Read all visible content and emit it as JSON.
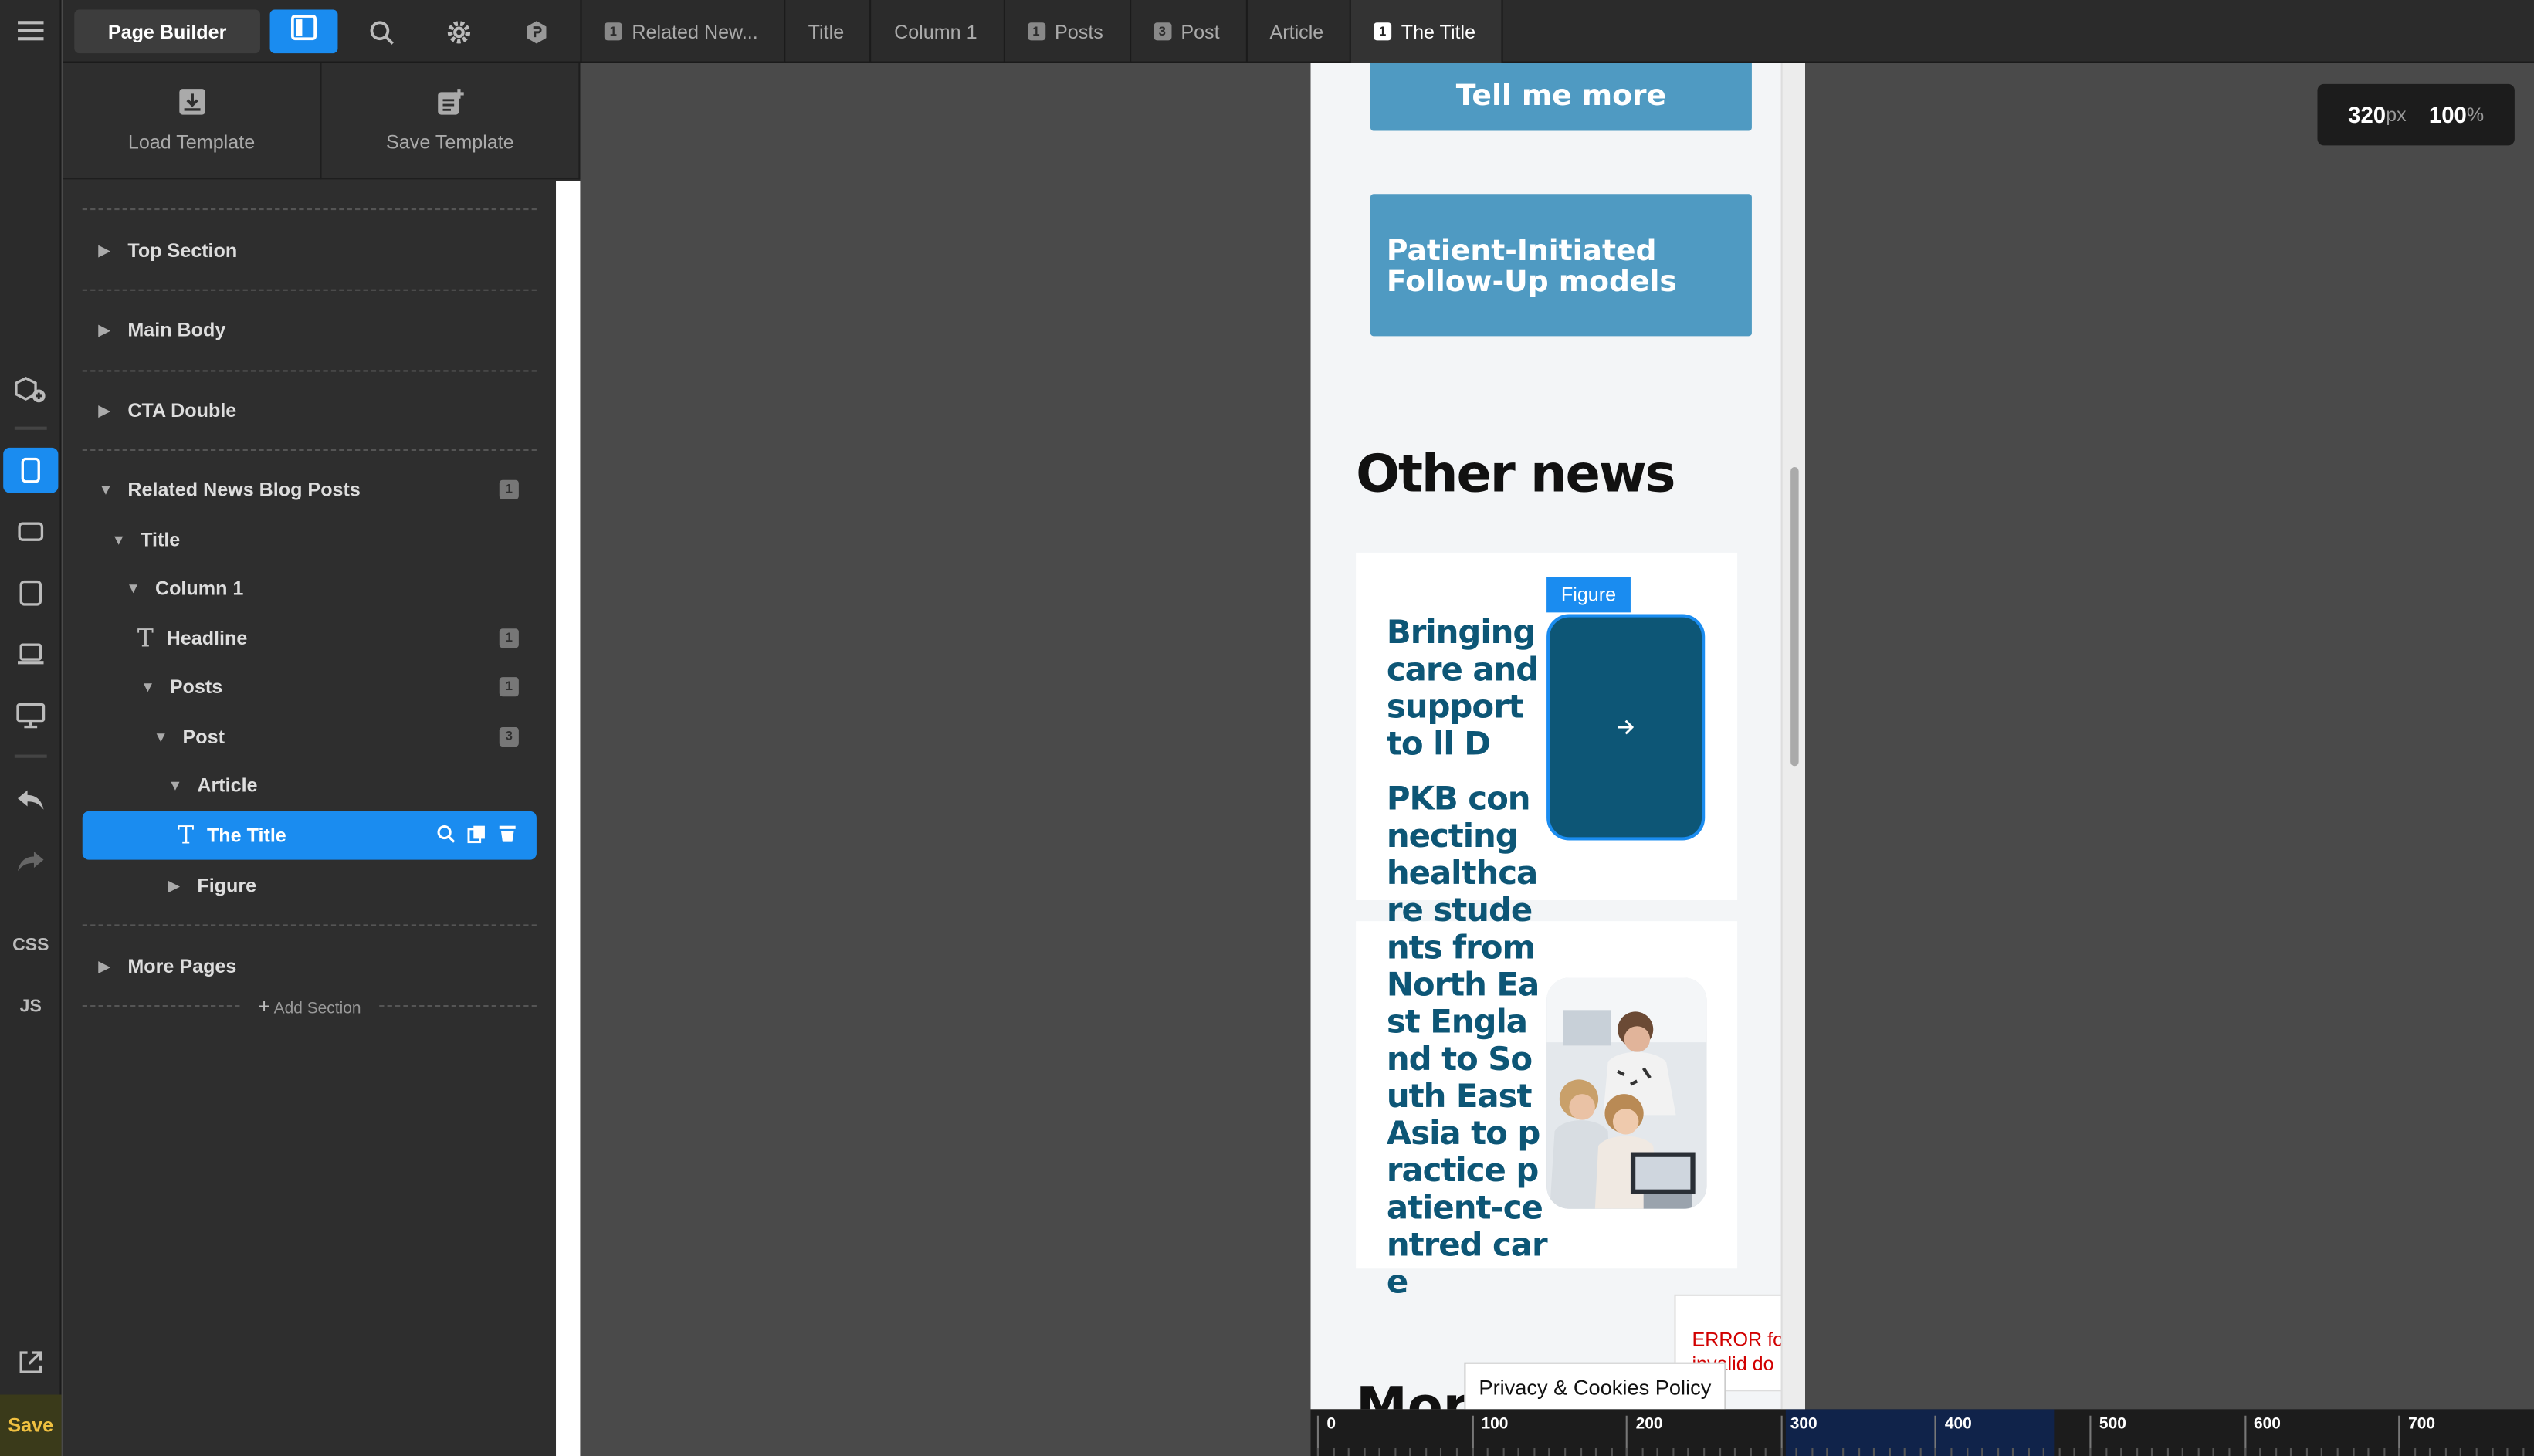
{
  "toolbar": {
    "page_builder_label": "Page Builder",
    "icons": [
      "menu-icon",
      "layers-icon",
      "search-icon",
      "gear-icon",
      "wp-icon"
    ]
  },
  "breadcrumbs": [
    {
      "badge": "1",
      "label": "Related New..."
    },
    {
      "badge": "",
      "label": "Title"
    },
    {
      "badge": "",
      "label": "Column 1"
    },
    {
      "badge": "1",
      "label": "Posts"
    },
    {
      "badge": "3",
      "label": "Post"
    },
    {
      "badge": "",
      "label": "Article"
    },
    {
      "badge": "1",
      "label": "The Title",
      "active": true
    }
  ],
  "rail": {
    "css_label": "CSS",
    "js_label": "JS",
    "save_label": "Save"
  },
  "templates": {
    "load_label": "Load Template",
    "save_label": "Save Template"
  },
  "tree": {
    "top_section": "Top Section",
    "main_body": "Main Body",
    "cta_double": "CTA Double",
    "related_news": "Related News Blog Posts",
    "related_news_badge": "1",
    "title": "Title",
    "column1": "Column 1",
    "headline": "Headline",
    "headline_badge": "1",
    "posts": "Posts",
    "posts_badge": "1",
    "post": "Post",
    "post_badge": "3",
    "article": "Article",
    "the_title": "The Title",
    "figure": "Figure",
    "more_pages": "More Pages",
    "add_section": "Add Section"
  },
  "preview": {
    "cta_top": "Tell me more",
    "cta_patient": "Patient-Initiated Follow-Up models",
    "other_news": "Other news",
    "figure_label": "Figure",
    "post1_title": "Bringing care and support to ll D",
    "post2_title": "PKB connecting healthcare students from North East England to South East Asia to practice patient-centred care",
    "error_text": "ERROR for invalid do",
    "privacy": "Privacy & Cookies Policy",
    "more_heading": "Mor"
  },
  "size_indicator": {
    "width": "320",
    "width_unit": "px",
    "zoom": "100",
    "zoom_unit": "%"
  },
  "ruler": {
    "labels": [
      "0",
      "100",
      "200",
      "300",
      "400",
      "500",
      "600",
      "700"
    ]
  },
  "colors": {
    "accent": "#1a8cf0",
    "headline": "#0d5676",
    "cta": "#4f9ac2",
    "save": "#f0c040"
  }
}
